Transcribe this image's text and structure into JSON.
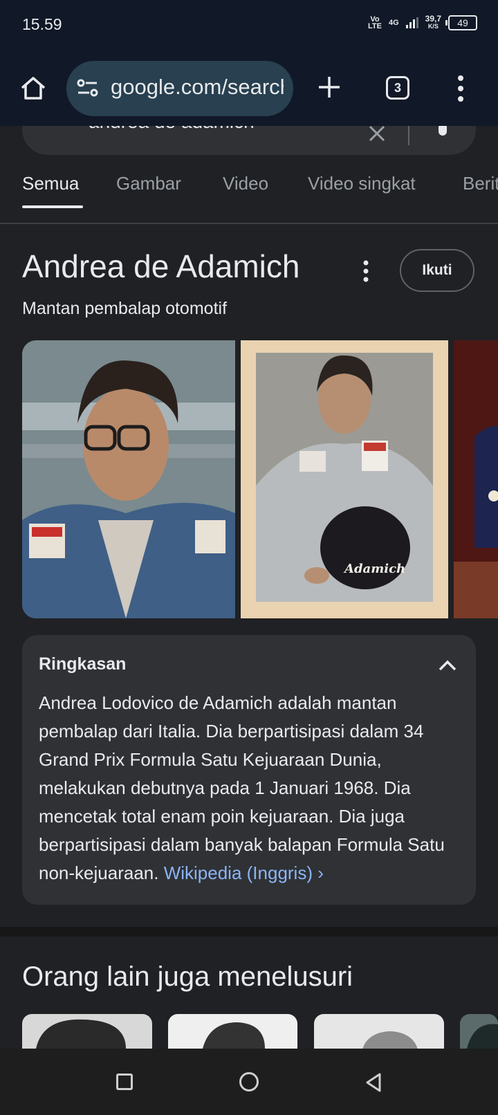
{
  "status_bar": {
    "time": "15.59",
    "volte": "Vo\nLTE",
    "network": "4G",
    "speed_value": "39,7",
    "speed_unit": "K/S",
    "battery": "49"
  },
  "browser": {
    "url": "google.com/search",
    "tab_count": "3"
  },
  "search": {
    "query": "andrea de adamich"
  },
  "tabs": [
    {
      "label": "Semua",
      "active": true
    },
    {
      "label": "Gambar"
    },
    {
      "label": "Video"
    },
    {
      "label": "Video singkat"
    },
    {
      "label": "Berita"
    }
  ],
  "knowledge_panel": {
    "title": "Andrea de Adamich",
    "subtitle": "Mantan pembalap otomotif",
    "follow_label": "Ikuti",
    "summary": {
      "heading": "Ringkasan",
      "text": "Andrea Lodovico de Adamich adalah mantan pembalap dari Italia. Dia berpartisipasi dalam 34 Grand Prix Formula Satu Kejuaraan Dunia, melakukan debutnya pada 1 Januari 1968. Dia mencetak total enam poin kejuaraan. Dia juga berpartisipasi dalam banyak balapan Formula Satu non-kejuaraan.",
      "link": "Wikipedia (Inggris)",
      "link_chevron": "›"
    },
    "photo_2_helmet_text": "Adamich"
  },
  "people_also_search": {
    "heading": "Orang lain juga menelusuri"
  },
  "colors": {
    "background": "#202124",
    "card": "#303134",
    "link": "#8ab4f8",
    "toolbar": "#111827",
    "urlbar": "#284050"
  }
}
